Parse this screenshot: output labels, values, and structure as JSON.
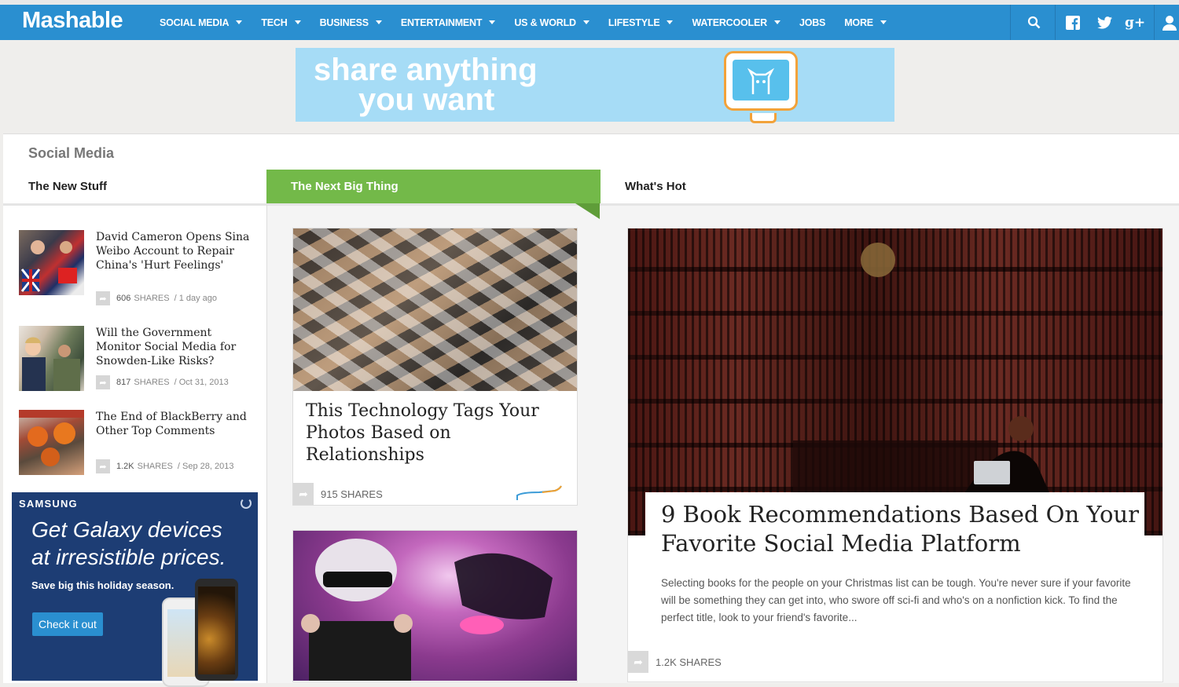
{
  "nav": {
    "logo": "Mashable",
    "items": [
      "SOCIAL MEDIA",
      "TECH",
      "BUSINESS",
      "ENTERTAINMENT",
      "US & WORLD",
      "LIFESTYLE",
      "WATERCOOLER",
      "JOBS",
      "MORE"
    ],
    "has_caret": [
      true,
      true,
      true,
      true,
      true,
      true,
      true,
      false,
      true
    ],
    "icons": [
      "search-icon",
      "facebook-icon",
      "twitter-icon",
      "google-plus-icon",
      "user-icon"
    ]
  },
  "top_ad": {
    "line1": "share anything",
    "line2": "you want"
  },
  "section": {
    "title": "Social Media",
    "col1_heading": "The New Stuff",
    "col2_heading": "The Next Big Thing",
    "col3_heading": "What's Hot"
  },
  "new_stuff": [
    {
      "title": "David Cameron Opens Sina Weibo Account to Repair China's 'Hurt Feelings'",
      "shares": "606",
      "shares_label": "SHARES",
      "date": "/ 1 day ago"
    },
    {
      "title": "Will the Government Monitor Social Media for Snowden-Like Risks?",
      "shares": "817",
      "shares_label": "SHARES",
      "date": "/ Oct 31, 2013"
    },
    {
      "title": "The End of BlackBerry and Other Top Comments",
      "shares": "1.2K",
      "shares_label": "SHARES",
      "date": "/ Sep 28, 2013"
    }
  ],
  "samsung_ad": {
    "brand": "SAMSUNG",
    "headline_1": "Get Galaxy devices",
    "headline_2": "at irresistible prices.",
    "subline": "Save big this holiday season.",
    "button": "Check it out"
  },
  "next_big_thing": {
    "title": "This Technology Tags Your Photos Based on Relationships",
    "shares": "915 SHARES"
  },
  "whats_hot": {
    "title": "9 Book Recommendations Based On Your Favorite Social Media Platform",
    "description": "Selecting books for the people on your Christmas list can be tough. You're never sure if your favorite will be something they can get into, who swore off sci-fi and who's on a nonfiction kick. To find the perfect title, look to your friend's favorite...",
    "shares": "1.2K SHARES"
  },
  "colors": {
    "nav_blue": "#2a8fd0",
    "accent_green": "#73b949",
    "ad_sky": "#a6dcf6",
    "samsung_navy": "#1d3d74"
  }
}
